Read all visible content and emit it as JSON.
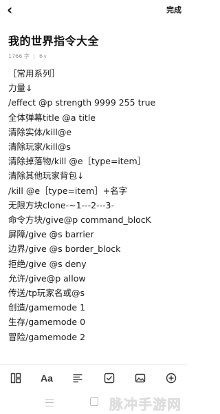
{
  "header": {
    "back_icon": "chevron-left-icon",
    "done_label": "完成"
  },
  "note": {
    "title": "我的世界指令大全",
    "word_count": "1766 字",
    "font_size": "6",
    "lines": [
      "［常用系列］",
      "力量↓",
      "/effect @p strength 9999 255 true",
      "全体弹幕title  @a  title",
      "清除实体/kill@e",
      "清除玩家/kill@s",
      "清除掉落物/kill @e［type=item］",
      "清除其他玩家背包↓",
      "/kill @e［type=item］+名字",
      "无限方块clone-~1---2---3-",
      "命令方块/give@p command_blocK",
      "屏障/give @s barrier",
      "边界/give @s border_block",
      "拒绝/give @s deny",
      "允许/give@p allow",
      "传送/tp玩家名或@s",
      "创造/gamemode 1",
      "生存/gamemode 0",
      "冒险/gamemode 2"
    ]
  },
  "toolbar": {
    "icons": [
      "layout-icon",
      "text-format-icon",
      "paragraph-icon",
      "checkbox-icon",
      "image-icon",
      "add-icon"
    ],
    "text_format_label": "Aa"
  },
  "watermark": "脉冲手游网"
}
